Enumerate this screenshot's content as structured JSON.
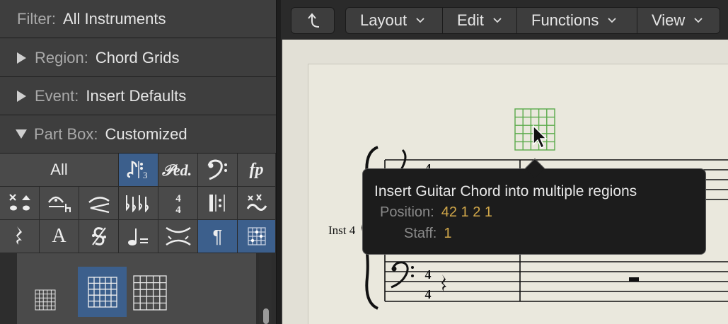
{
  "inspector": {
    "filter": {
      "label": "Filter:",
      "value": "All Instruments"
    },
    "region": {
      "label": "Region:",
      "value": "Chord Grids"
    },
    "event": {
      "label": "Event:",
      "value": "Insert Defaults"
    },
    "partbox": {
      "label": "Part Box:",
      "value": "Customized"
    },
    "part_buttons": {
      "all": "All",
      "pedal": "𝆮",
      "dynamics": "fp",
      "text": "A"
    }
  },
  "toolbar": {
    "layout": "Layout",
    "edit": "Edit",
    "functions": "Functions",
    "view": "View"
  },
  "score": {
    "instrument_label": "Inst 4"
  },
  "tooltip": {
    "title": "Insert Guitar Chord into multiple regions",
    "position_label": "Position:",
    "position_value": "42 1 2 1",
    "staff_label": "Staff:",
    "staff_value": "1"
  },
  "colors": {
    "selection": "#3c5f8c",
    "tooltip_value": "#d2a84a",
    "chord_grid_green": "#5aaa4a"
  }
}
